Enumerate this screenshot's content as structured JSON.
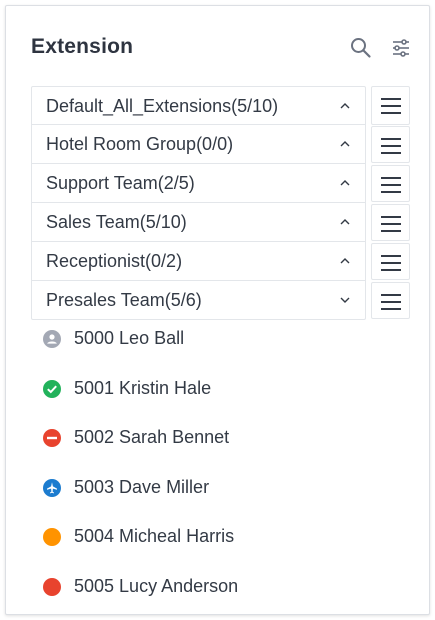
{
  "panel": {
    "title": "Extension"
  },
  "icons": {
    "search": "search-icon",
    "filter": "sliders-icon",
    "menu": "menu-icon"
  },
  "groups": [
    {
      "label": "Default_All_Extensions(5/10)",
      "expanded": false
    },
    {
      "label": "Hotel Room Group(0/0)",
      "expanded": false
    },
    {
      "label": "Support Team(2/5)",
      "expanded": false
    },
    {
      "label": "Sales Team(5/10)",
      "expanded": false
    },
    {
      "label": "Receptionist(0/2)",
      "expanded": false
    },
    {
      "label": "Presales Team(5/6)",
      "expanded": true
    }
  ],
  "members": [
    {
      "label": "5000 Leo Ball",
      "status": "offline",
      "color": "#a3a8b4"
    },
    {
      "label": "5001 Kristin Hale",
      "status": "available",
      "color": "#22b25b"
    },
    {
      "label": "5002 Sarah Bennet",
      "status": "do-not-disturb",
      "color": "#e8432e"
    },
    {
      "label": "5003 Dave Miller",
      "status": "away-travel",
      "color": "#1c7ccf"
    },
    {
      "label": "5004 Micheal Harris",
      "status": "away",
      "color": "#ff9300"
    },
    {
      "label": "5005 Lucy Anderson",
      "status": "busy",
      "color": "#e8432e"
    }
  ]
}
